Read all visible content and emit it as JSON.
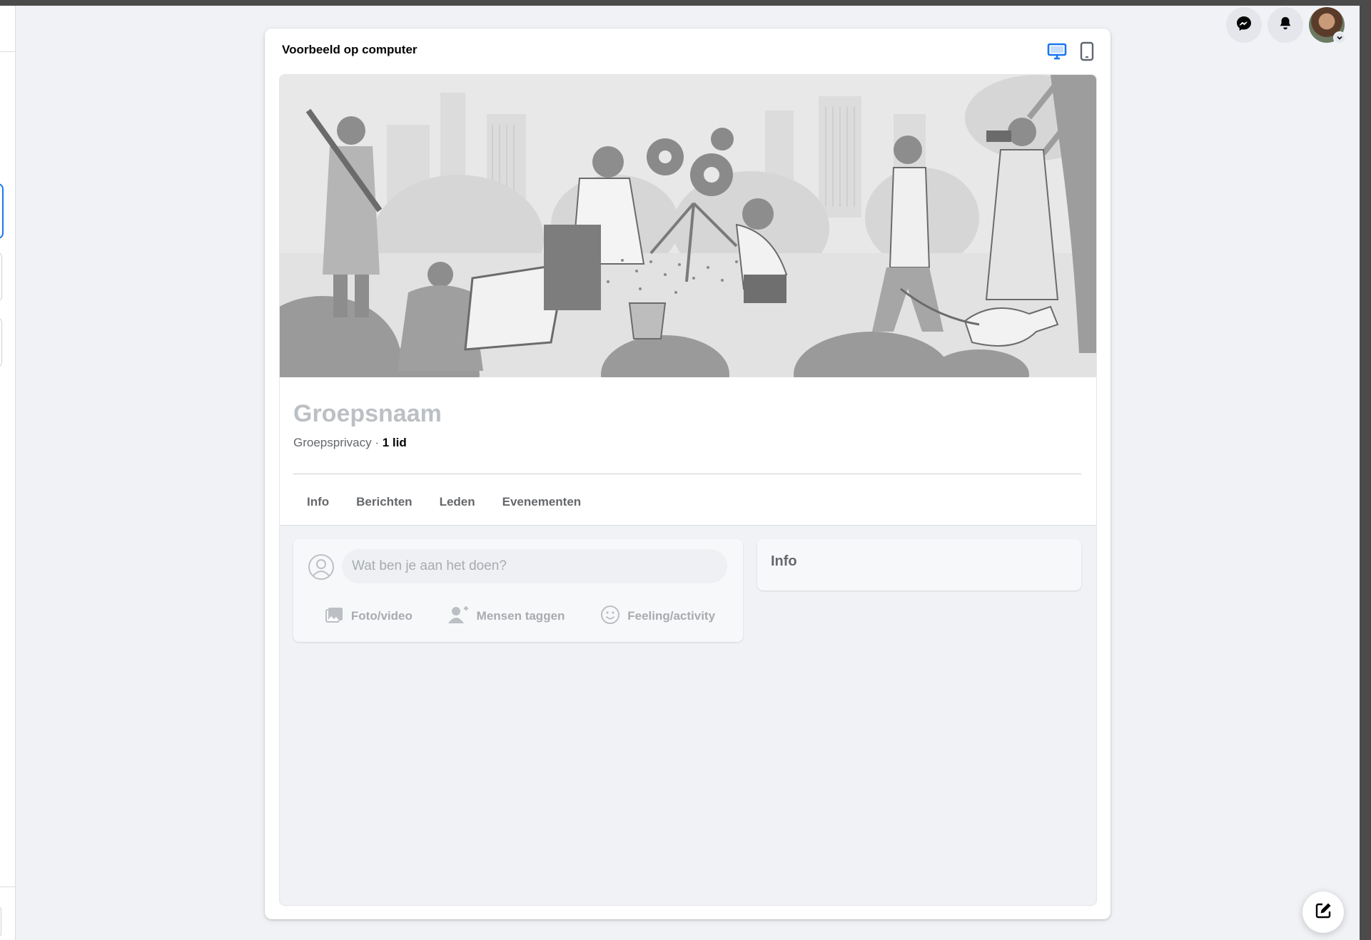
{
  "preview": {
    "title": "Voorbeeld op computer",
    "active_device": "desktop",
    "accent_color": "#1877f2"
  },
  "group": {
    "name": "Groepsnaam",
    "privacy": "Groepsprivacy",
    "separator": " · ",
    "members": "1 lid"
  },
  "tabs": [
    {
      "label": "Info"
    },
    {
      "label": "Berichten"
    },
    {
      "label": "Leden"
    },
    {
      "label": "Evenementen"
    }
  ],
  "composer": {
    "placeholder": "Wat ben je aan het doen?",
    "actions": [
      {
        "label": "Foto/video",
        "icon": "photo-icon"
      },
      {
        "label": "Mensen taggen",
        "icon": "tag-people-icon"
      },
      {
        "label": "Feeling/activity",
        "icon": "smiley-icon"
      }
    ]
  },
  "info_card": {
    "title": "Info"
  },
  "top_icons": [
    "messenger-icon",
    "bell-icon",
    "avatar"
  ],
  "fab_icon": "compose-icon"
}
